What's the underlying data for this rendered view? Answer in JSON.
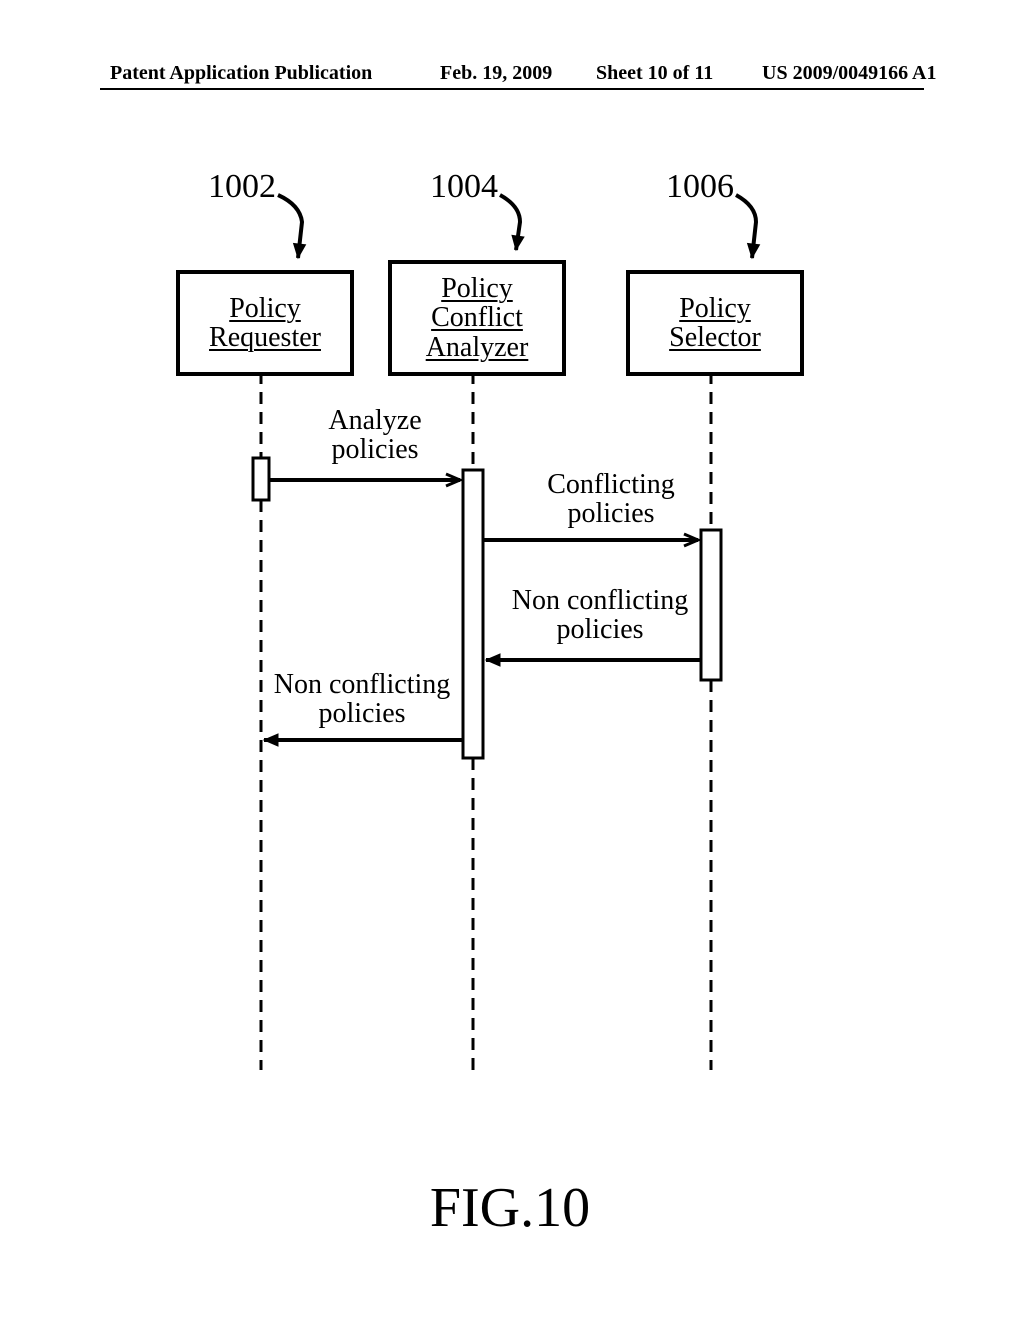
{
  "header": {
    "left": "Patent Application Publication",
    "date": "Feb. 19, 2009",
    "sheet": "Sheet 10 of 11",
    "pubnum": "US 2009/0049166 A1"
  },
  "refs": {
    "r1002": "1002",
    "r1004": "1004",
    "r1006": "1006"
  },
  "lifelines": {
    "requester": "Policy\nRequester",
    "analyzer": "Policy\nConflict\nAnalyzer",
    "selector": "Policy\nSelector"
  },
  "messages": {
    "analyze": "Analyze\npolicies",
    "conflicting": "Conflicting\npolicies",
    "nonconf_return1": "Non conflicting\npolicies",
    "nonconf_return2": "Non conflicting\npolicies"
  },
  "figure_caption": "FIG.10"
}
